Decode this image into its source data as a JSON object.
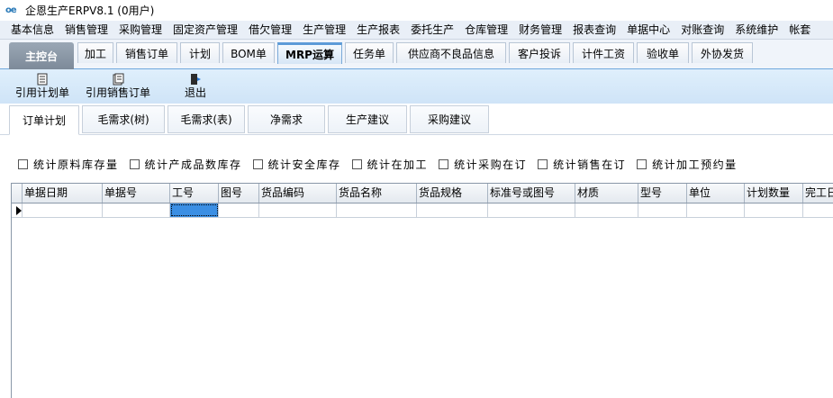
{
  "window": {
    "title": "企恩生产ERPV8.1 (0用户)",
    "logo": "oe"
  },
  "menu": [
    "基本信息",
    "销售管理",
    "采购管理",
    "固定资产管理",
    "借欠管理",
    "生产管理",
    "生产报表",
    "委托生产",
    "仓库管理",
    "财务管理",
    "报表查询",
    "单据中心",
    "对账查询",
    "系统维护",
    "帐套"
  ],
  "nav": {
    "home": "主控台",
    "tabs": [
      "加工",
      "销售订单",
      "计划",
      "BOM单",
      "MRP运算",
      "任务单",
      "供应商不良品信息",
      "客户投诉",
      "计件工资",
      "验收单",
      "外协发货"
    ],
    "active": "MRP运算"
  },
  "toolbar": {
    "ref_plan": "引用计划单",
    "ref_sales": "引用销售订单",
    "exit": "退出"
  },
  "subtabs": {
    "items": [
      "订单计划",
      "毛需求(树)",
      "毛需求(表)",
      "净需求",
      "生产建议",
      "采购建议"
    ],
    "active": "订单计划"
  },
  "filters": [
    "统计原料库存量",
    "统计产成品数库存",
    "统计安全库存",
    "统计在加工",
    "统计采购在订",
    "统计销售在订",
    "统计加工预约量"
  ],
  "grid": {
    "columns": [
      "单据日期",
      "单据号",
      "工号",
      "图号",
      "货品编码",
      "货品名称",
      "货品规格",
      "标准号或图号",
      "材质",
      "型号",
      "单位",
      "计划数量",
      "完工日"
    ]
  },
  "colors": {
    "accent": "#5c9bd8",
    "selected_cell": "#3b8fe4",
    "toolbar_bg": "#d8eafa"
  }
}
